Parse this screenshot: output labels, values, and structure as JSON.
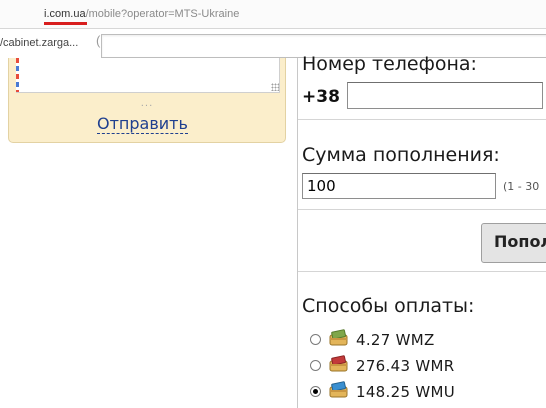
{
  "browser": {
    "url_host": "i.com.ua",
    "url_rest": "/mobile?operator=MTS-Ukraine",
    "bookmark_label": "/cabinet.zarga...",
    "bookmark_separator": "("
  },
  "feedback": {
    "dots": "...",
    "send_label": "Отправить"
  },
  "form": {
    "phone_label": "Номер телефона:",
    "phone_prefix": "+38",
    "phone_value": "",
    "amount_label": "Сумма пополнения:",
    "amount_value": "100",
    "amount_hint": "(1 - 30",
    "submit_label": "Попол",
    "methods_label": "Способы оплаты:",
    "methods": [
      {
        "amount": "4.27 WMZ",
        "selected": false,
        "color": "#7fa64a"
      },
      {
        "amount": "276.43 WMR",
        "selected": false,
        "color": "#c23a3a"
      },
      {
        "amount": "148.25 WMU",
        "selected": true,
        "color": "#3a8fd0"
      }
    ]
  },
  "colors": {
    "feedback_bg": "#fbeecb",
    "link": "#1f3f8f",
    "url_underline": "#d81e1e"
  }
}
